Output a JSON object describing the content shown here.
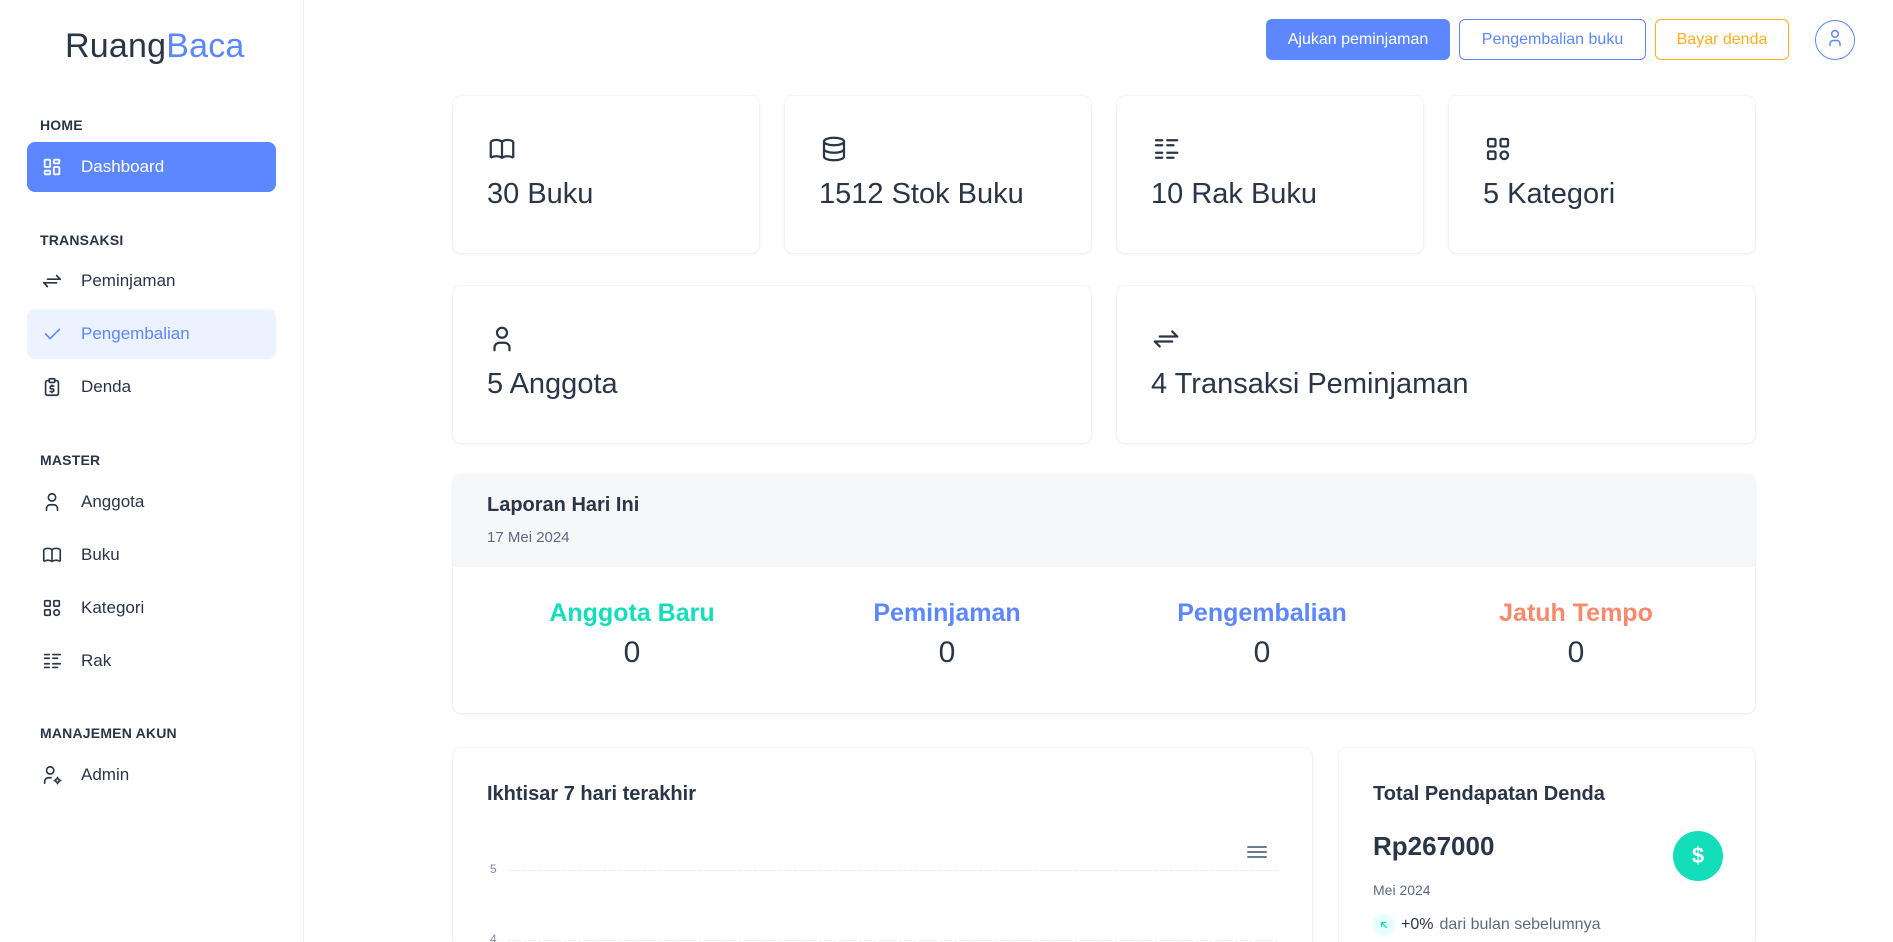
{
  "brand": {
    "part1": "Ruang",
    "part2": "Baca"
  },
  "sidebar": {
    "sections": [
      "HOME",
      "TRANSAKSI",
      "MASTER",
      "MANAJEMEN AKUN"
    ],
    "items": [
      {
        "label": "Dashboard",
        "icon": "dashboard-icon"
      },
      {
        "label": "Peminjaman",
        "icon": "arrows-exchange-icon"
      },
      {
        "label": "Pengembalian",
        "icon": "check-icon"
      },
      {
        "label": "Denda",
        "icon": "clipboard-dollar-icon"
      },
      {
        "label": "Anggota",
        "icon": "user-icon"
      },
      {
        "label": "Buku",
        "icon": "book-icon"
      },
      {
        "label": "Kategori",
        "icon": "category-icon"
      },
      {
        "label": "Rak",
        "icon": "list-details-icon"
      },
      {
        "label": "Admin",
        "icon": "user-cog-icon"
      }
    ]
  },
  "topbar": {
    "btn_borrow": "Ajukan peminjaman",
    "btn_return": "Pengembalian buku",
    "btn_fine": "Bayar denda"
  },
  "stats": [
    {
      "text": "30 Buku",
      "icon": "book-icon"
    },
    {
      "text": "1512 Stok Buku",
      "icon": "database-icon"
    },
    {
      "text": "10 Rak Buku",
      "icon": "list-details-icon"
    },
    {
      "text": "5 Kategori",
      "icon": "category-icon"
    },
    {
      "text": "5 Anggota",
      "icon": "user-icon"
    },
    {
      "text": "4 Transaksi Peminjaman",
      "icon": "arrows-exchange-icon"
    }
  ],
  "report": {
    "title": "Laporan Hari Ini",
    "date": "17 Mei 2024",
    "metrics": [
      {
        "label": "Anggota Baru",
        "value": "0",
        "color": "#13deb9"
      },
      {
        "label": "Peminjaman",
        "value": "0",
        "color": "#5d87ff"
      },
      {
        "label": "Pengembalian",
        "value": "0",
        "color": "#5d87ff"
      },
      {
        "label": "Jatuh Tempo",
        "value": "0",
        "color": "#fa896b"
      }
    ]
  },
  "overview": {
    "title": "Ikhtisar 7 hari terakhir",
    "ticks": [
      "5",
      "4"
    ]
  },
  "fines": {
    "title": "Total Pendapatan Denda",
    "amount": "Rp267000",
    "month": "Mei 2024",
    "change_pct": "+0%",
    "change_text": "dari bulan sebelumnya",
    "icon": "dollar-icon"
  },
  "colors": {
    "primary": "#5d87ff",
    "primary_light": "#ecf2ff",
    "success": "#13deb9",
    "warning": "#ffae1f",
    "danger": "#fa896b",
    "text": "#2a3547"
  }
}
